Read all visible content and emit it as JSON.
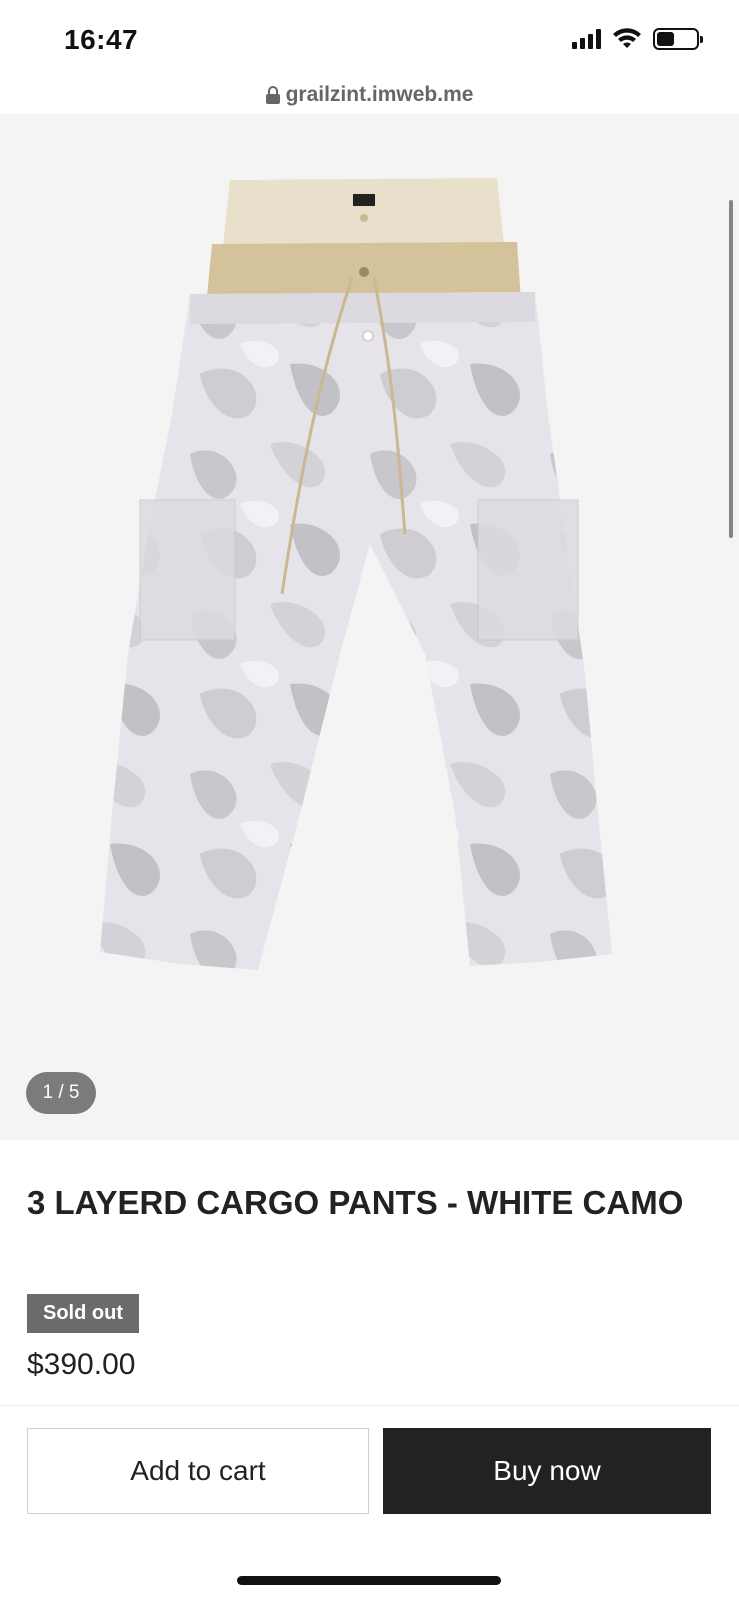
{
  "status_bar": {
    "time": "16:47",
    "icons": [
      "signal-icon",
      "wifi-icon",
      "battery-icon"
    ]
  },
  "browser": {
    "url": "grailzint.imweb.me",
    "icon": "lock-icon"
  },
  "gallery": {
    "counter": "1 / 5",
    "image": "product-photo-layered-camo-cargo-pants"
  },
  "product": {
    "title": "3 LAYERD CARGO PANTS - WHITE CAMO",
    "badge": "Sold out",
    "price": "$390.00"
  },
  "actions": {
    "add_to_cart": "Add to cart",
    "buy_now": "Buy now"
  },
  "colors": {
    "badge_bg": "#6b6b6b",
    "buy_button_bg": "#222222",
    "gallery_bg": "#f4f4f4"
  }
}
